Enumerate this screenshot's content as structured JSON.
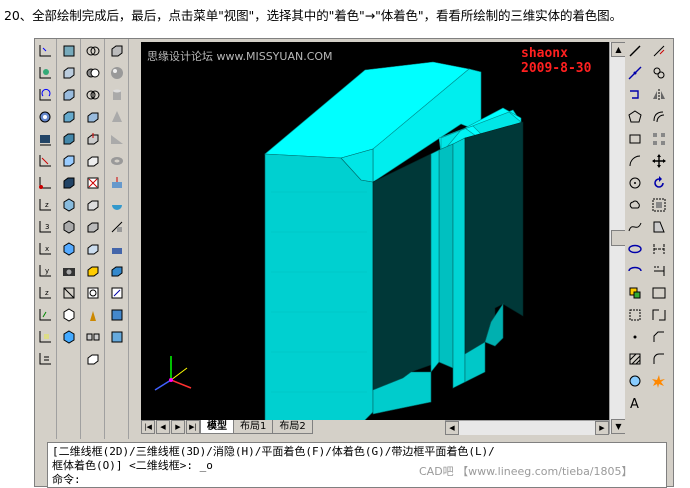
{
  "instruction": "20、全部绘制完成后，最后，点击菜单\"视图\"，选择其中的\"着色\"→\"体着色\"，看看所绘制的三维实体的着色图。",
  "viewport": {
    "watermark": "思缘设计论坛 www.MISSYUAN.COM",
    "signature": "shaonx 2009-8-30"
  },
  "tabs": [
    {
      "label": "模型",
      "active": true
    },
    {
      "label": "布局1",
      "active": false
    },
    {
      "label": "布局2",
      "active": false
    }
  ],
  "command": {
    "line1": "[二维线框(2D)/三维线框(3D)/消隐(H)/平面着色(F)/体着色(G)/带边框平面着色(L)/",
    "line2": "框体着色(O)] <二维线框>: _o",
    "line3": "命令:"
  },
  "credit": "CAD吧 【www.lineeg.com/tieba/1805】",
  "colors": {
    "solid_top": "#00ffff",
    "solid_front": "#00c8c8",
    "solid_side": "#004848",
    "background": "#000000"
  }
}
